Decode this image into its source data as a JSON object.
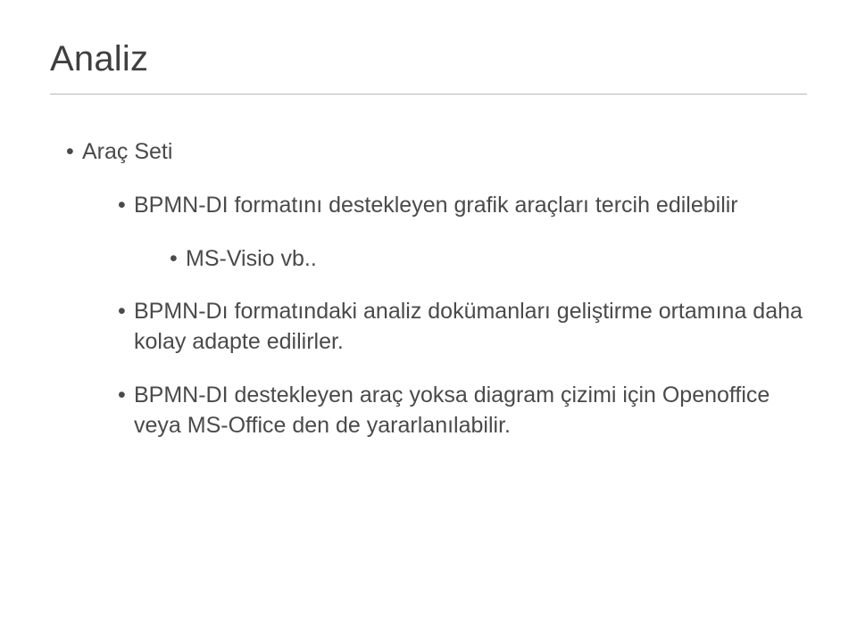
{
  "title": "Analiz",
  "bullets": {
    "l1": {
      "text": "Araç Seti",
      "children": [
        {
          "text": "BPMN-DI formatını destekleyen grafik araçları tercih edilebilir",
          "children": [
            {
              "text": "MS-Visio vb.."
            }
          ]
        },
        {
          "text": "BPMN-Dı formatındaki analiz dokümanları geliştirme ortamına daha kolay adapte edilirler."
        },
        {
          "text": "BPMN-DI destekleyen araç yoksa diagram çizimi için Openoffice veya MS-Office den de yararlanılabilir."
        }
      ]
    }
  }
}
